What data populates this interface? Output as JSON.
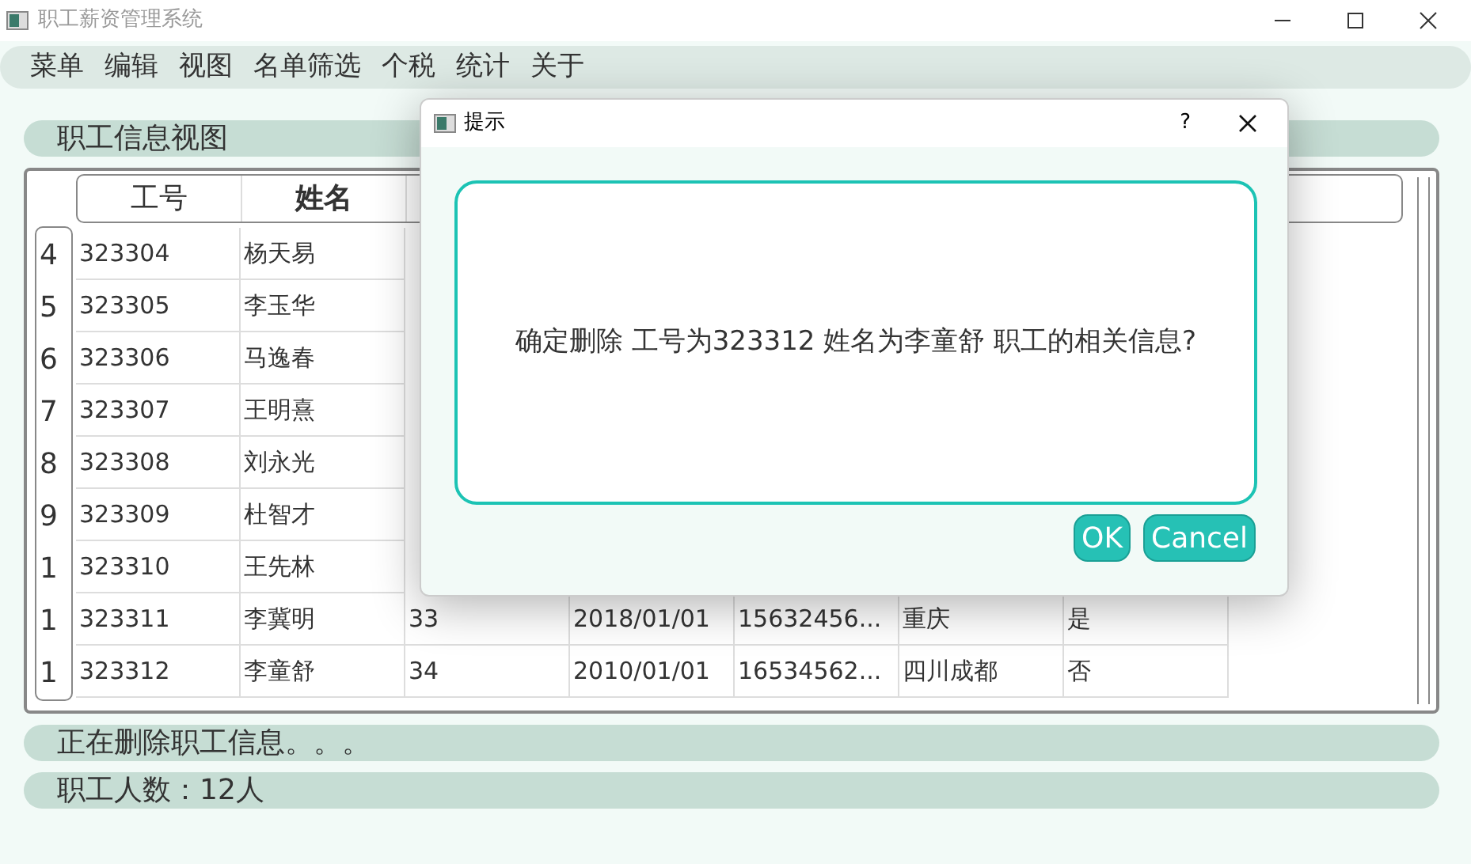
{
  "window": {
    "title": "职工薪资管理系统"
  },
  "menu": [
    "菜单",
    "编辑",
    "视图",
    "名单筛选",
    "个税",
    "统计",
    "关于"
  ],
  "panel_title": "职工信息视图",
  "table": {
    "columns": [
      "工号",
      "姓名"
    ],
    "rows": [
      {
        "number": "4",
        "cells": [
          "323304",
          "杨天易"
        ]
      },
      {
        "number": "5",
        "cells": [
          "323305",
          "李玉华"
        ]
      },
      {
        "number": "6",
        "cells": [
          "323306",
          "马逸春"
        ]
      },
      {
        "number": "7",
        "cells": [
          "323307",
          "王明熹"
        ]
      },
      {
        "number": "8",
        "cells": [
          "323308",
          "刘永光"
        ]
      },
      {
        "number": "9",
        "cells": [
          "323309",
          "杜智才"
        ]
      },
      {
        "number": "1",
        "cells": [
          "323310",
          "王先林"
        ]
      },
      {
        "number": "1",
        "cells": [
          "323311",
          "李冀明",
          "33",
          "2018/01/01",
          "15632456...",
          "重庆",
          "是"
        ]
      },
      {
        "number": "1",
        "cells": [
          "323312",
          "李童舒",
          "34",
          "2010/01/01",
          "16534562...",
          "四川成都",
          "否"
        ]
      }
    ]
  },
  "status": [
    "正在删除职工信息。。。",
    "职工人数：12人"
  ],
  "dialog": {
    "title": "提示",
    "help": "?",
    "message": "确定删除 工号为323312 姓名为李童舒 职工的相关信息?",
    "buttons": [
      "OK",
      "Cancel"
    ]
  }
}
